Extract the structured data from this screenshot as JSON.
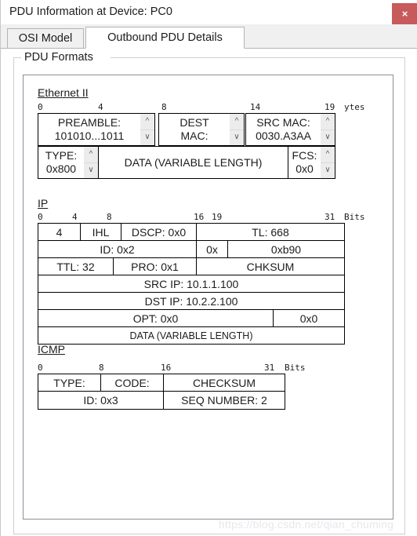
{
  "window": {
    "title": "PDU Information at Device: PC0",
    "close_label": "×"
  },
  "tabs": [
    {
      "label": "OSI Model",
      "active": false
    },
    {
      "label": "Outbound PDU Details",
      "active": true
    }
  ],
  "groupbox": {
    "label": "PDU Formats"
  },
  "sections": {
    "ethernet": {
      "title": "Ethernet II",
      "ruler": {
        "ticks": [
          "0",
          "4",
          "8",
          "14",
          "19"
        ],
        "unit": "ytes"
      },
      "row1": [
        {
          "line1": "PREAMBLE:",
          "line2": "101010...1011",
          "spinner": true
        },
        {
          "line1": "DEST",
          "line2": "MAC:",
          "spinner": true
        },
        {
          "line1": "SRC MAC:",
          "line2": "0030.A3AA",
          "spinner": true
        }
      ],
      "row2": [
        {
          "line1": "TYPE:",
          "line2": "0x800",
          "spinner": true
        },
        {
          "line1": "DATA (VARIABLE LENGTH)",
          "line2": "",
          "spinner": false
        },
        {
          "line1": "FCS:",
          "line2": "0x0",
          "spinner": true
        }
      ]
    },
    "ip": {
      "title": "IP",
      "ruler": {
        "ticks": [
          "0",
          "4",
          "8",
          "16",
          "19",
          "31"
        ],
        "unit": "Bits"
      },
      "rows": [
        [
          "4",
          "IHL",
          "DSCP: 0x0",
          "TL: 668"
        ],
        [
          "ID: 0x2",
          "0x",
          "0xb90"
        ],
        [
          "TTL: 32",
          "PRO: 0x1",
          "CHKSUM"
        ],
        [
          "SRC IP: 10.1.1.100"
        ],
        [
          "DST IP: 10.2.2.100"
        ],
        [
          "OPT: 0x0",
          "0x0"
        ],
        [
          "DATA (VARIABLE LENGTH)"
        ]
      ]
    },
    "icmp": {
      "title": "ICMP",
      "ruler": {
        "ticks": [
          "0",
          "8",
          "16",
          "31"
        ],
        "unit": "Bits"
      },
      "rows": [
        [
          "TYPE:",
          "CODE:",
          "CHECKSUM"
        ],
        [
          "ID: 0x3",
          "SEQ NUMBER: 2"
        ]
      ]
    }
  },
  "watermark": {
    "text": "https://blog.csdn.net/qian_chuming"
  },
  "colors": {
    "close_button": "#c75b5b",
    "tab_border": "#b4b4b4",
    "panel_border": "#8a8f99",
    "groupbox_border": "#cfcfcf",
    "spinner_bg": "#ececec"
  }
}
